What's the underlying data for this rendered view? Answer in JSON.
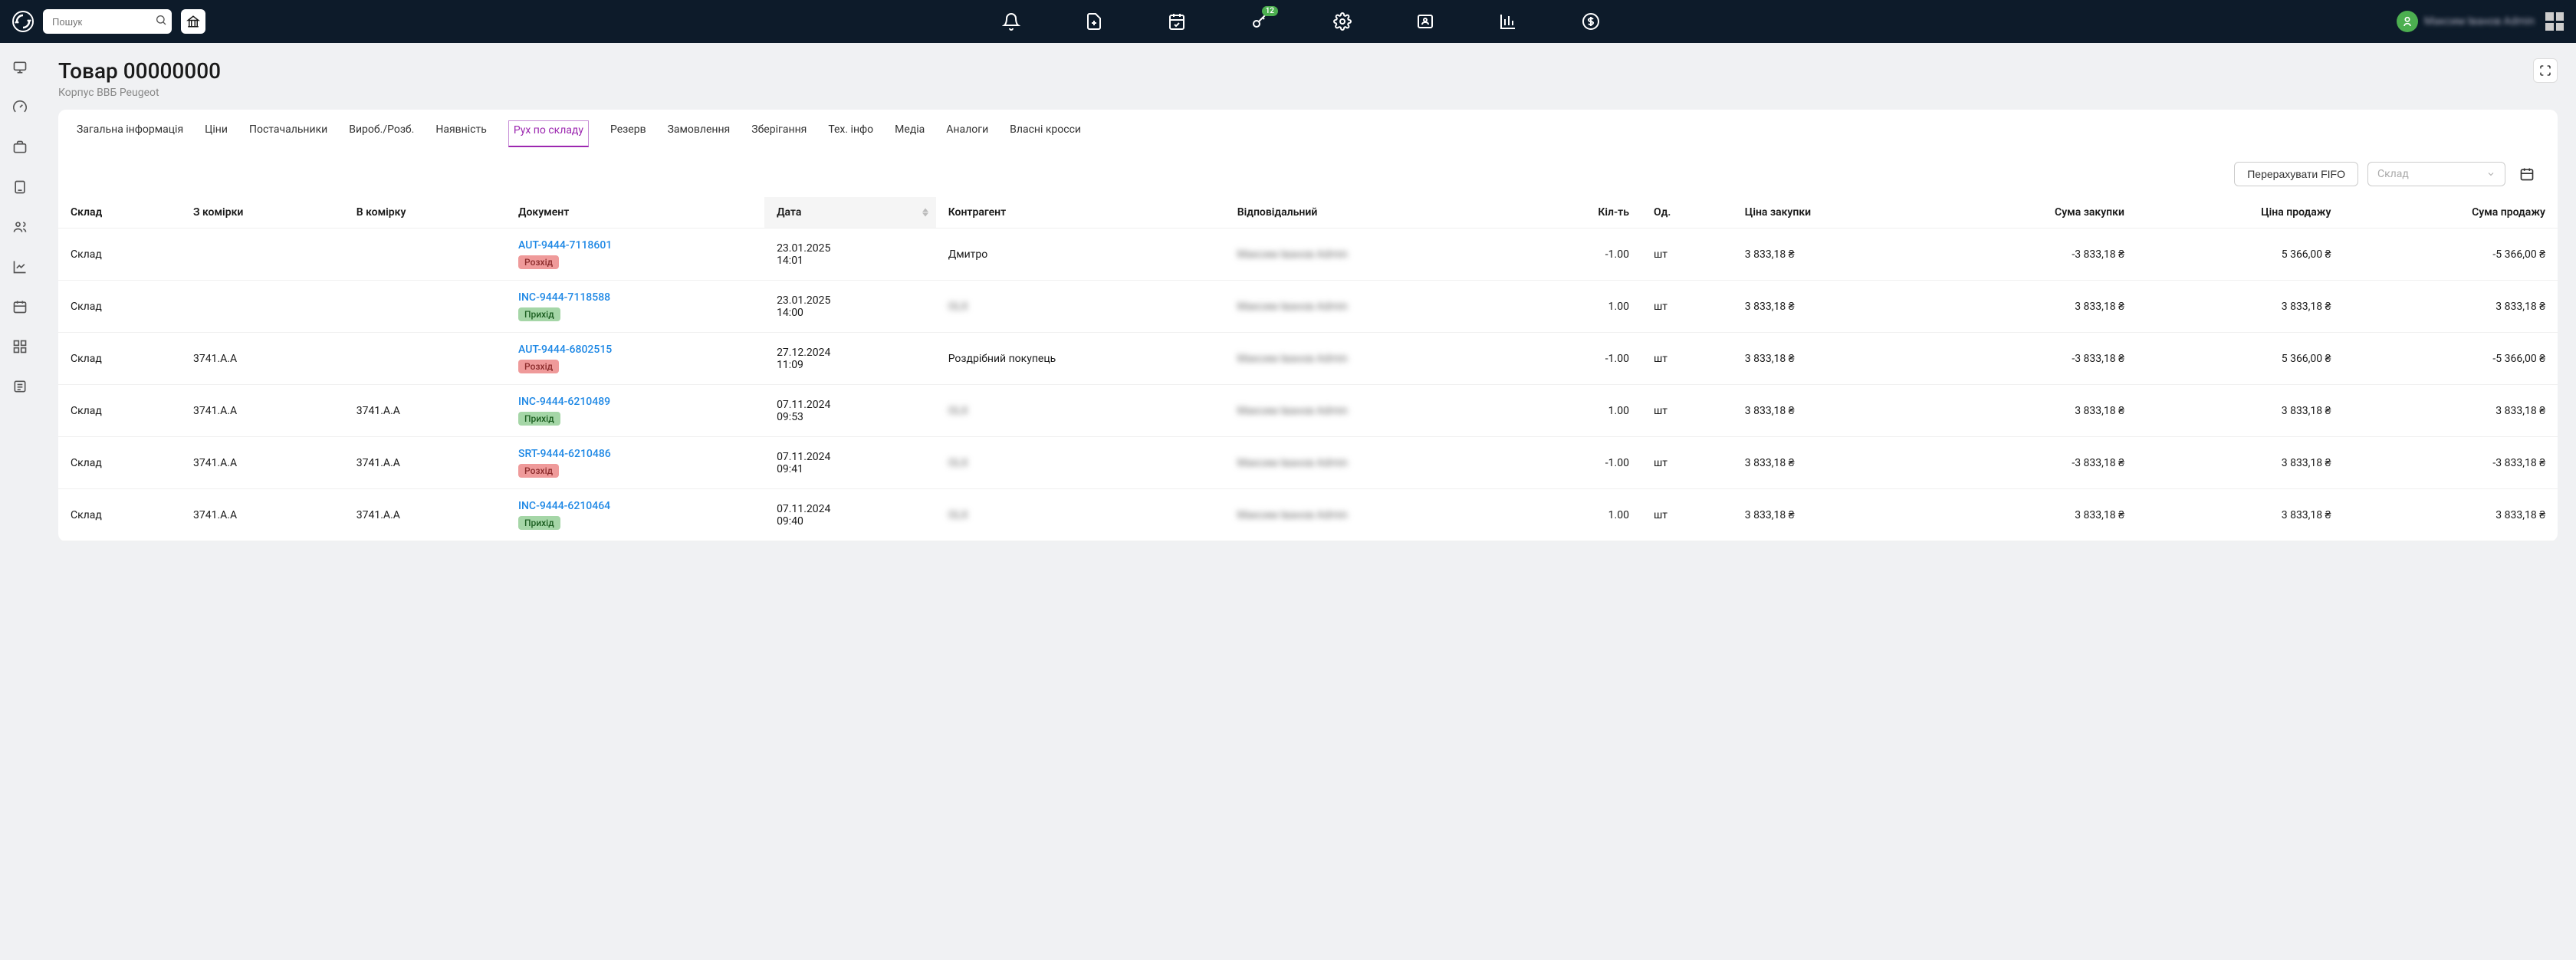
{
  "search": {
    "placeholder": "Пошук"
  },
  "badges": {
    "key_count": "12"
  },
  "user": {
    "name": "Максим Іванов Admin"
  },
  "page": {
    "title": "Товар 00000000",
    "subtitle": "Корпус ВВБ Peugeot"
  },
  "tabs": [
    "Загальна інформація",
    "Ціни",
    "Постачальники",
    "Вироб./Розб.",
    "Наявність",
    "Рух по складу",
    "Резерв",
    "Замовлення",
    "Зберігання",
    "Тех. інфо",
    "Медіа",
    "Аналоги",
    "Власні кросси"
  ],
  "active_tab": "Рух по складу",
  "toolbar": {
    "recalc_fifo": "Перерахувати FIFO",
    "warehouse_placeholder": "Склад"
  },
  "columns": {
    "warehouse": "Склад",
    "from_cell": "З комірки",
    "to_cell": "В комірку",
    "document": "Документ",
    "date": "Дата",
    "counterparty": "Контрагент",
    "responsible": "Відповідальний",
    "qty": "Кіл-ть",
    "unit": "Од.",
    "purchase_price": "Ціна закупки",
    "purchase_sum": "Сума закупки",
    "sale_price": "Ціна продажу",
    "sale_sum": "Сума продажу"
  },
  "tag_labels": {
    "out": "Розхід",
    "in": "Прихід"
  },
  "blurred_responsible": "Максим Іванов Admin",
  "blurred_olx": "OLX",
  "rows": [
    {
      "warehouse": "Склад",
      "from_cell": "",
      "to_cell": "",
      "doc": "AUT-9444-7118601",
      "doc_tag": "out",
      "date": "23.01.2025",
      "time": "14:01",
      "counterparty": "Дмитро",
      "counterparty_blurred": false,
      "qty": "-1.00",
      "unit": "шт",
      "purchase_price": "3 833,18 ₴",
      "purchase_sum": "-3 833,18 ₴",
      "sale_price": "5 366,00 ₴",
      "sale_sum": "-5 366,00 ₴"
    },
    {
      "warehouse": "Склад",
      "from_cell": "",
      "to_cell": "",
      "doc": "INC-9444-7118588",
      "doc_tag": "in",
      "date": "23.01.2025",
      "time": "14:00",
      "counterparty": "OLX",
      "counterparty_blurred": true,
      "qty": "1.00",
      "unit": "шт",
      "purchase_price": "3 833,18 ₴",
      "purchase_sum": "3 833,18 ₴",
      "sale_price": "3 833,18 ₴",
      "sale_sum": "3 833,18 ₴"
    },
    {
      "warehouse": "Склад",
      "from_cell": "3741.A.A",
      "to_cell": "",
      "doc": "AUT-9444-6802515",
      "doc_tag": "out",
      "date": "27.12.2024",
      "time": "11:09",
      "counterparty": "Роздрібний покупець",
      "counterparty_blurred": false,
      "qty": "-1.00",
      "unit": "шт",
      "purchase_price": "3 833,18 ₴",
      "purchase_sum": "-3 833,18 ₴",
      "sale_price": "5 366,00 ₴",
      "sale_sum": "-5 366,00 ₴"
    },
    {
      "warehouse": "Склад",
      "from_cell": "3741.A.A",
      "to_cell": "3741.A.A",
      "doc": "INC-9444-6210489",
      "doc_tag": "in",
      "date": "07.11.2024",
      "time": "09:53",
      "counterparty": "OLX",
      "counterparty_blurred": true,
      "qty": "1.00",
      "unit": "шт",
      "purchase_price": "3 833,18 ₴",
      "purchase_sum": "3 833,18 ₴",
      "sale_price": "3 833,18 ₴",
      "sale_sum": "3 833,18 ₴"
    },
    {
      "warehouse": "Склад",
      "from_cell": "3741.A.A",
      "to_cell": "3741.A.A",
      "doc": "SRT-9444-6210486",
      "doc_tag": "out",
      "date": "07.11.2024",
      "time": "09:41",
      "counterparty": "OLX",
      "counterparty_blurred": true,
      "qty": "-1.00",
      "unit": "шт",
      "purchase_price": "3 833,18 ₴",
      "purchase_sum": "-3 833,18 ₴",
      "sale_price": "3 833,18 ₴",
      "sale_sum": "-3 833,18 ₴"
    },
    {
      "warehouse": "Склад",
      "from_cell": "3741.A.A",
      "to_cell": "3741.A.A",
      "doc": "INC-9444-6210464",
      "doc_tag": "in",
      "date": "07.11.2024",
      "time": "09:40",
      "counterparty": "OLX",
      "counterparty_blurred": true,
      "qty": "1.00",
      "unit": "шт",
      "purchase_price": "3 833,18 ₴",
      "purchase_sum": "3 833,18 ₴",
      "sale_price": "3 833,18 ₴",
      "sale_sum": "3 833,18 ₴"
    }
  ]
}
